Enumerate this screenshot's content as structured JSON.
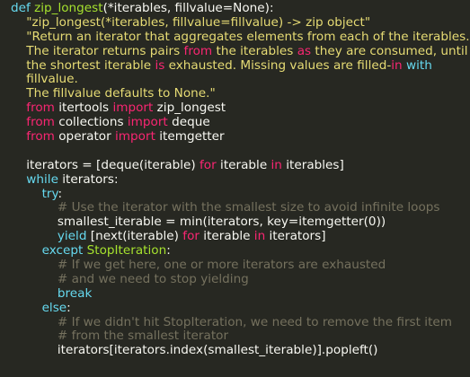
{
  "editor": {
    "colors": {
      "background": "#272822",
      "keyword": "#66d9ef",
      "function_name": "#a6e22e",
      "string": "#e6db74",
      "operator": "#f92672",
      "comment": "#75715e",
      "text": "#f8f8f2"
    },
    "lines": [
      [
        [
          "kw",
          "def "
        ],
        [
          "fn",
          "zip_longest"
        ],
        [
          "id",
          "(*iterables, fillvalue=None):"
        ]
      ],
      [
        [
          "str",
          "    \"zip_longest(*iterables, fillvalue=fillvalue) -> zip object\""
        ]
      ],
      [
        [
          "str",
          "    \"Return an iterator that aggregates elements from each of the iterables."
        ]
      ],
      [
        [
          "str",
          "    The iterator returns pairs "
        ],
        [
          "op",
          "from"
        ],
        [
          "str",
          " the iterables "
        ],
        [
          "op",
          "as"
        ],
        [
          "str",
          " they are consumed, until"
        ]
      ],
      [
        [
          "str",
          "    the shortest iterable "
        ],
        [
          "op",
          "is"
        ],
        [
          "str",
          " exhausted. Missing values are filled-"
        ],
        [
          "op",
          "in"
        ],
        [
          "str",
          " "
        ],
        [
          "kw",
          "with"
        ]
      ],
      [
        [
          "str",
          "    fillvalue."
        ]
      ],
      [
        [
          "str",
          "    The fillvalue defaults to None.\""
        ]
      ],
      [
        [
          "op",
          "    from"
        ],
        [
          "id",
          " itertools "
        ],
        [
          "op",
          "import"
        ],
        [
          "id",
          " zip_longest"
        ]
      ],
      [
        [
          "op",
          "    from"
        ],
        [
          "id",
          " collections "
        ],
        [
          "op",
          "import"
        ],
        [
          "id",
          " deque"
        ]
      ],
      [
        [
          "op",
          "    from"
        ],
        [
          "id",
          " operator "
        ],
        [
          "op",
          "import"
        ],
        [
          "id",
          " itemgetter"
        ]
      ],
      [
        [
          "id",
          ""
        ]
      ],
      [
        [
          "id",
          "    iterators = [deque(iterable) "
        ],
        [
          "op",
          "for"
        ],
        [
          "id",
          " iterable "
        ],
        [
          "op",
          "in"
        ],
        [
          "id",
          " iterables]"
        ]
      ],
      [
        [
          "kw",
          "    while"
        ],
        [
          "id",
          " iterators:"
        ]
      ],
      [
        [
          "kw",
          "        try"
        ],
        [
          "id",
          ":"
        ]
      ],
      [
        [
          "cm",
          "            # Use the iterator with the smallest size to avoid infinite loops"
        ]
      ],
      [
        [
          "id",
          "            smallest_iterable = min(iterators, key=itemgetter(0))"
        ]
      ],
      [
        [
          "kw",
          "            yield"
        ],
        [
          "id",
          " [next(iterable) "
        ],
        [
          "op",
          "for"
        ],
        [
          "id",
          " iterable "
        ],
        [
          "op",
          "in"
        ],
        [
          "id",
          " iterators]"
        ]
      ],
      [
        [
          "kw",
          "        except"
        ],
        [
          "id",
          " "
        ],
        [
          "fn",
          "StopIteration"
        ],
        [
          "id",
          ":"
        ]
      ],
      [
        [
          "cm",
          "            # If we get here, one or more iterators are exhausted"
        ]
      ],
      [
        [
          "cm",
          "            # and we need to stop yielding"
        ]
      ],
      [
        [
          "kw",
          "            break"
        ]
      ],
      [
        [
          "kw",
          "        else"
        ],
        [
          "id",
          ":"
        ]
      ],
      [
        [
          "cm",
          "            # If we didn't hit StopIteration, we need to remove the first item"
        ]
      ],
      [
        [
          "cm",
          "            # from the smallest iterator"
        ]
      ],
      [
        [
          "id",
          "            iterators[iterators.index(smallest_iterable)].popleft()"
        ]
      ]
    ]
  }
}
